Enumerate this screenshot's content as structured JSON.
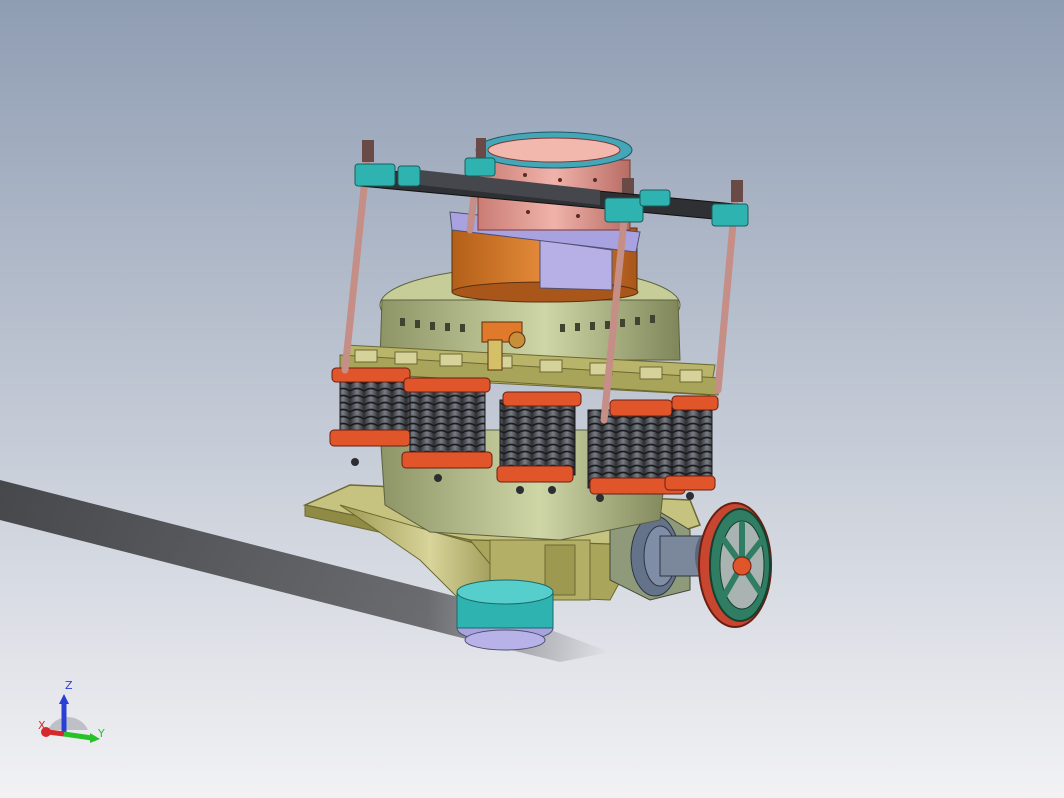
{
  "viewport": {
    "background_top": "#8f9db3",
    "background_bottom": "#f2f2f4"
  },
  "model": {
    "colors": {
      "frame_olive": "#b8b56a",
      "frame_olive_dark": "#8a8740",
      "bowl_green": "#aeb784",
      "spring_gray": "#4a4d52",
      "spring_cap_orange": "#e0552a",
      "hopper_pink": "#e59a90",
      "collar_orange": "#d9782a",
      "ring_lavender": "#a9a2e0",
      "bracket_teal": "#2fb3b0",
      "beam_dark": "#2f3033",
      "rod_pink": "#c58e86",
      "pulley_green": "#2f7d62",
      "belt_red": "#c8452f",
      "shadow": "#1e1e20"
    }
  },
  "triad": {
    "z_label": "Z",
    "y_label": "Y",
    "x_label": "X",
    "z_color": "#2a3fd6",
    "y_color": "#27c228",
    "x_color": "#d62a2a"
  }
}
